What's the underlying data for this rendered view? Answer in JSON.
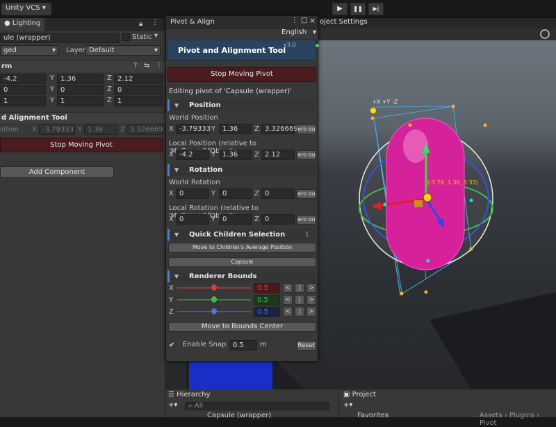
{
  "toolbar": {
    "vcs_label": "Unity VCS ▾",
    "play_icon": "▶",
    "pause_icon": "❚❚",
    "step_icon": "▶|"
  },
  "inspector": {
    "tab_label": "Lighting",
    "object_name": "ule (wrapper)",
    "static_label": "Static",
    "tag_value": "ged",
    "layer_label": "Layer",
    "layer_value": "Default",
    "transform_header": "rm",
    "rows": [
      {
        "x": "-4.2",
        "y": "1.36",
        "z": "2.12"
      },
      {
        "x": "0",
        "y": "0",
        "z": "0"
      },
      {
        "x": "1",
        "y": "1",
        "z": "1"
      }
    ],
    "tool_header": "d Alignment Tool",
    "pos_label": "sition",
    "pos": {
      "x": "-3.79333",
      "y": "1.36",
      "z": "3.326669"
    },
    "stop_label": "Stop Moving Pivot",
    "add_component": "Add Component"
  },
  "scene": {
    "settings_tab": "oject Settings",
    "gizmo_label": "+X +Y -Z",
    "pivot_coords": "(-3.79, 1.36, 3.33)"
  },
  "pivot_window": {
    "title": "Pivot & Align",
    "language": "English",
    "tool_title": "Pivot and Alignment Tool",
    "version": "v3.0",
    "stop_label": "Stop Moving Pivot",
    "editing_label": "Editing pivot of 'Capsule (wrapper)'",
    "position_header": "Position",
    "world_position_label": "World Position",
    "world_position": {
      "x": "-3.79333",
      "y": "1.36",
      "z": "3.326669"
    },
    "local_position_label": "Local Position (relative to 'MyGroupOfObjects",
    "local_position": {
      "x": "-4.2",
      "y": "1.36",
      "z": "2.12"
    },
    "zero_btn": "ero ou",
    "rotation_header": "Rotation",
    "world_rotation_label": "World Rotation",
    "world_rotation": {
      "x": "0",
      "y": "0",
      "z": "0"
    },
    "local_rotation_label": "Local Rotation (relative to 'MyGroupOfObjects",
    "local_rotation": {
      "x": "0",
      "y": "0",
      "z": "0"
    },
    "children_header": "Quick Children Selection",
    "children_count": "1",
    "move_children_btn": "Move to Children's Average Position",
    "capsule_btn": "Capsule",
    "bounds_header": "Renderer Bounds",
    "bounds": [
      {
        "axis": "X",
        "value": "0.5",
        "color": "#d04040",
        "box": "#4a1a1a",
        "fraction": 0.5
      },
      {
        "axis": "Y",
        "value": "0.5",
        "color": "#3cbf4a",
        "box": "#1a3a1a",
        "fraction": 0.5
      },
      {
        "axis": "Z",
        "value": "0.5",
        "color": "#4a78e0",
        "box": "#1a2240",
        "fraction": 0.5
      }
    ],
    "lt": "<",
    "mid": "|",
    "gt": ">",
    "bounds_center_btn": "Move to Bounds Center",
    "snap_check": "✔",
    "snap_label": "Enable Snap",
    "snap_value": "0.5",
    "snap_unit": "m",
    "reset_btn": "Reset"
  },
  "bottom": {
    "hierarchy_tab": "Hierarchy",
    "search_placeholder": "All",
    "hierarchy_item": "Capsule (wrapper)",
    "project_tab": "Project",
    "favorites": "Favorites",
    "assets_path": "Assets › Plugins › Pivot"
  },
  "colors": {
    "accent": "#4a7bd0",
    "stop_red": "#4a1c1f",
    "capsule": "#d6229a"
  }
}
